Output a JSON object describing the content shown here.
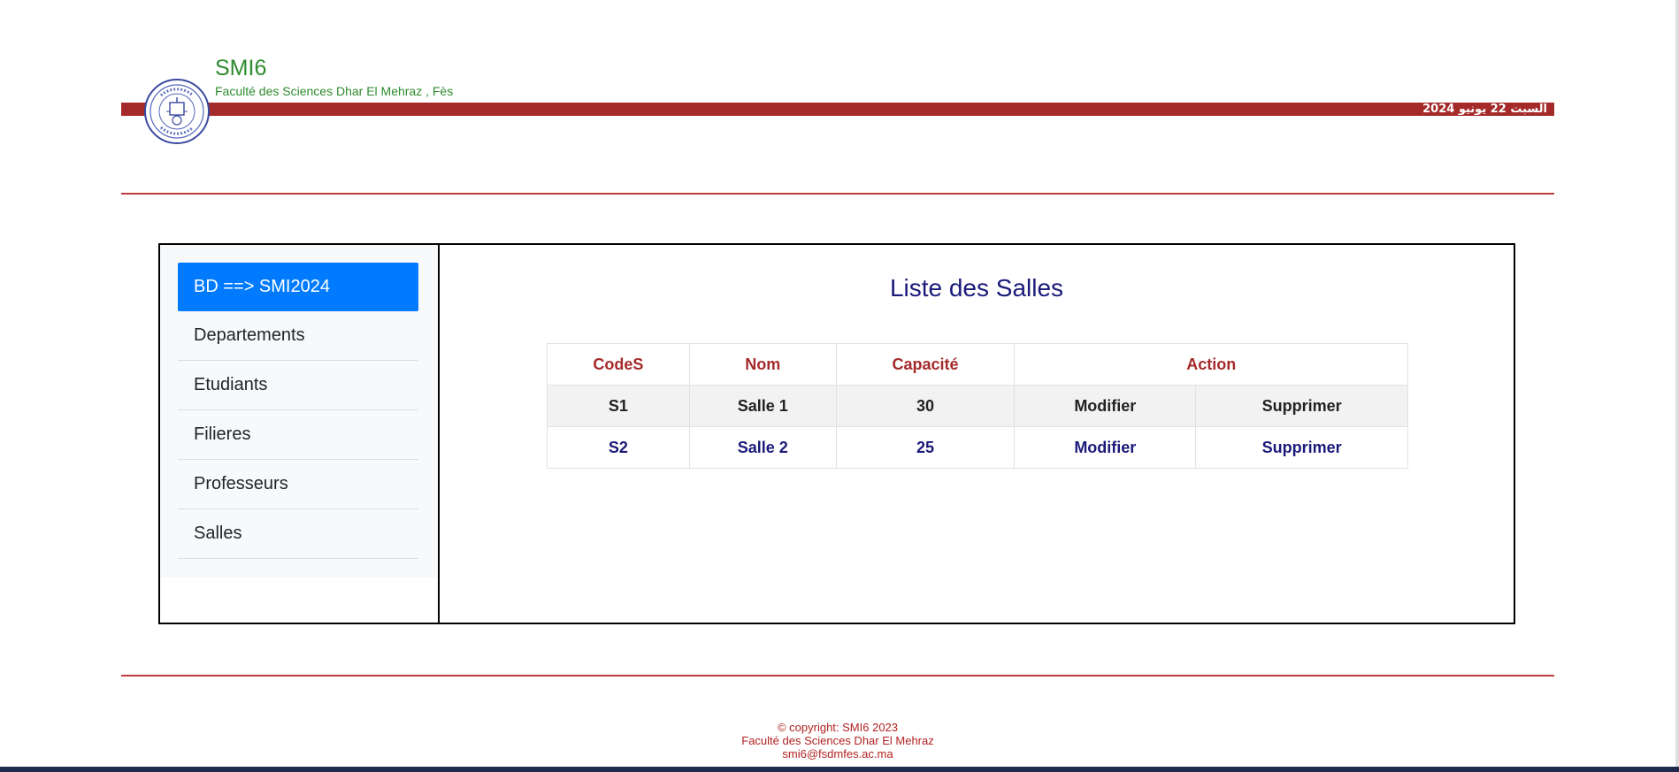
{
  "header": {
    "title": "SMI6",
    "subtitle": "Faculté des Sciences Dhar El Mehraz , Fès",
    "date": "السبت 22 يونيو 2024",
    "logo": "university-seal-logo"
  },
  "sidebar": {
    "items": [
      {
        "label": "BD ==> SMI2024",
        "active": true
      },
      {
        "label": "Departements"
      },
      {
        "label": "Etudiants"
      },
      {
        "label": "Filieres"
      },
      {
        "label": "Professeurs"
      },
      {
        "label": "Salles"
      }
    ]
  },
  "main": {
    "title": "Liste des Salles",
    "table": {
      "headers": [
        "CodeS",
        "Nom",
        "Capacité",
        "Action"
      ],
      "rows": [
        {
          "code": "S1",
          "nom": "Salle 1",
          "capacite": "30",
          "modifier": "Modifier",
          "supprimer": "Supprimer"
        },
        {
          "code": "S2",
          "nom": "Salle 2",
          "capacite": "25",
          "modifier": "Modifier",
          "supprimer": "Supprimer"
        }
      ]
    }
  },
  "footer": {
    "copyright": "© copyright: SMI6 2023",
    "faculty": "Faculté des Sciences Dhar El Mehraz",
    "email": "smi6@fsdmfes.ac.ma"
  },
  "colors": {
    "accent_red": "#a52a2a",
    "brand_green": "#2e8b2e",
    "active_blue": "#007bff",
    "title_navy": "#1a1a7a"
  }
}
